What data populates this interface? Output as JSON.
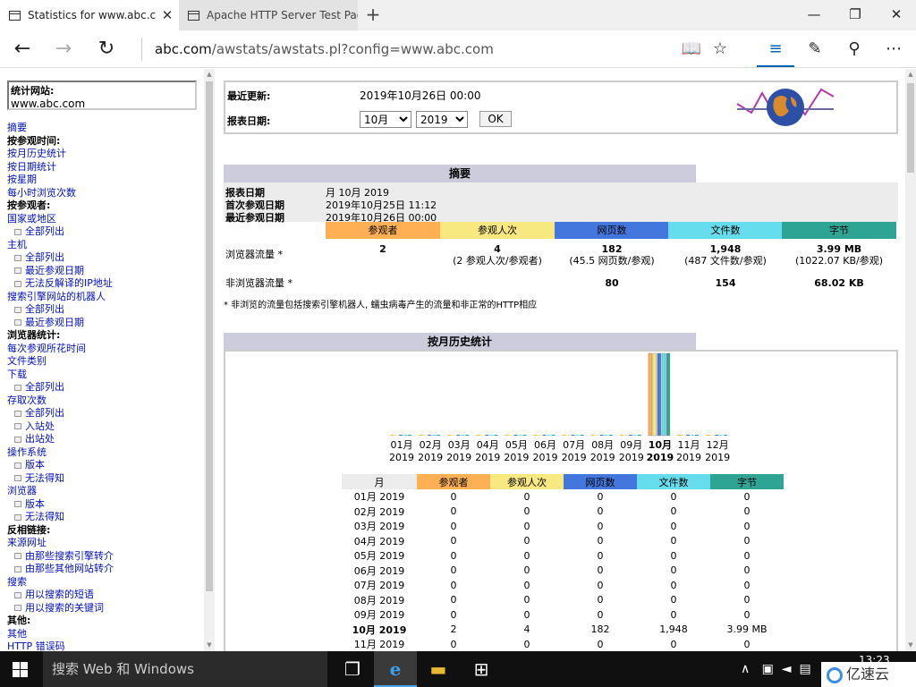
{
  "browser": {
    "tabs": [
      {
        "title": "Statistics for www.abc.co",
        "active": true
      },
      {
        "title": "Apache HTTP Server Test Pag",
        "active": false
      }
    ],
    "new_tab": "+",
    "address": {
      "host": "abc.com",
      "path": "/awstats/awstats.pl?config=www.abc.com"
    },
    "icons": [
      "back-icon",
      "forward-icon",
      "refresh-icon",
      "reading-view-icon",
      "favorites-star-icon",
      "hub-icon",
      "web-note-icon",
      "share-icon",
      "more-icon"
    ]
  },
  "left": {
    "site_label": "统计网站:",
    "site_value": "www.abc.com",
    "menu": [
      {
        "type": "link",
        "text": "摘要"
      },
      {
        "type": "head",
        "text": "按参观时间:"
      },
      {
        "type": "link",
        "text": "按月历史统计"
      },
      {
        "type": "link",
        "text": "按日期统计"
      },
      {
        "type": "link",
        "text": "按星期"
      },
      {
        "type": "link",
        "text": "每小时浏览次数"
      },
      {
        "type": "head",
        "text": "按参观者:"
      },
      {
        "type": "link",
        "text": "国家或地区"
      },
      {
        "type": "sub",
        "text": "全部列出"
      },
      {
        "type": "link",
        "text": "主机"
      },
      {
        "type": "sub",
        "text": "全部列出"
      },
      {
        "type": "sub",
        "text": "最近参观日期"
      },
      {
        "type": "sub",
        "text": "无法反解译的IP地址"
      },
      {
        "type": "link",
        "text": "搜索引擎网站的机器人"
      },
      {
        "type": "sub",
        "text": "全部列出"
      },
      {
        "type": "sub",
        "text": "最近参观日期"
      },
      {
        "type": "head",
        "text": "浏览器统计:"
      },
      {
        "type": "link",
        "text": "每次参观所花时间"
      },
      {
        "type": "link",
        "text": "文件类别"
      },
      {
        "type": "link",
        "text": "下载"
      },
      {
        "type": "sub",
        "text": "全部列出"
      },
      {
        "type": "link",
        "text": "存取次数"
      },
      {
        "type": "sub",
        "text": "全部列出"
      },
      {
        "type": "sub",
        "text": "入站处"
      },
      {
        "type": "sub",
        "text": "出站处"
      },
      {
        "type": "link",
        "text": "操作系统"
      },
      {
        "type": "sub",
        "text": "版本"
      },
      {
        "type": "sub",
        "text": "无法得知"
      },
      {
        "type": "link",
        "text": "浏览器"
      },
      {
        "type": "sub",
        "text": "版本"
      },
      {
        "type": "sub",
        "text": "无法得知"
      },
      {
        "type": "head",
        "text": "反相链接:"
      },
      {
        "type": "link",
        "text": "来源网址"
      },
      {
        "type": "sub",
        "text": "由那些搜索引擎转介"
      },
      {
        "type": "sub",
        "text": "由那些其他网站转介"
      },
      {
        "type": "link",
        "text": "搜索"
      },
      {
        "type": "sub",
        "text": "用以搜索的短语"
      },
      {
        "type": "sub",
        "text": "用以搜索的关键词"
      },
      {
        "type": "head",
        "text": "其他:"
      },
      {
        "type": "link",
        "text": "其他"
      },
      {
        "type": "link",
        "text": "HTTP 错误码"
      }
    ]
  },
  "top": {
    "last_update_label": "最近更新:",
    "last_update_value": "2019年10月26日 00:00",
    "report_date_label": "报表日期:",
    "month_select": "10月",
    "year_select": "2019",
    "ok_label": "OK"
  },
  "summary": {
    "title": "摘要",
    "report_date_label": "报表日期",
    "report_date_value": "月 10月 2019",
    "first_visit_label": "首次参观日期",
    "first_visit_value": "2019年10月25日 11:12",
    "last_visit_label": "最近参观日期",
    "last_visit_value": "2019年10月26日 00:00",
    "columns": [
      "参观者",
      "参观人次",
      "网页数",
      "文件数",
      "字节"
    ],
    "column_colors": [
      "#ffb055",
      "#f8e880",
      "#4477dd",
      "#66dded",
      "#2ea495"
    ],
    "viewed_label": "浏览器流量 *",
    "viewed_values": [
      "2",
      "4",
      "182",
      "1,948",
      "3.99 MB"
    ],
    "viewed_sub": [
      "",
      "(2 参观人次/参观者)",
      "(45.5 网页数/参观)",
      "(487 文件数/参观)",
      "(1022.07 KB/参观)"
    ],
    "notviewed_label": "非浏览器流量 *",
    "notviewed_values": [
      "",
      "",
      "80",
      "154",
      "68.02 KB"
    ],
    "footnote": "* 非浏览的流量包括搜索引擎机器人, 蠕虫病毒产生的流量和非正常的HTTP相应"
  },
  "monthly": {
    "title": "按月历史统计",
    "table_headers": [
      "月",
      "参观者",
      "参观人次",
      "网页数",
      "文件数",
      "字节"
    ],
    "rows": [
      [
        "01月 2019",
        "0",
        "0",
        "0",
        "0",
        "0"
      ],
      [
        "02月 2019",
        "0",
        "0",
        "0",
        "0",
        "0"
      ],
      [
        "03月 2019",
        "0",
        "0",
        "0",
        "0",
        "0"
      ],
      [
        "04月 2019",
        "0",
        "0",
        "0",
        "0",
        "0"
      ],
      [
        "05月 2019",
        "0",
        "0",
        "0",
        "0",
        "0"
      ],
      [
        "06月 2019",
        "0",
        "0",
        "0",
        "0",
        "0"
      ],
      [
        "07月 2019",
        "0",
        "0",
        "0",
        "0",
        "0"
      ],
      [
        "08月 2019",
        "0",
        "0",
        "0",
        "0",
        "0"
      ],
      [
        "09月 2019",
        "0",
        "0",
        "0",
        "0",
        "0"
      ],
      [
        "10月 2019",
        "2",
        "4",
        "182",
        "1,948",
        "3.99 MB"
      ],
      [
        "11月 2019",
        "0",
        "0",
        "0",
        "0",
        "0"
      ]
    ],
    "current_row": 9
  },
  "chart_data": {
    "type": "bar",
    "categories": [
      "01月\n2019",
      "02月\n2019",
      "03月\n2019",
      "04月\n2019",
      "05月\n2019",
      "06月\n2019",
      "07月\n2019",
      "08月\n2019",
      "09月\n2019",
      "10月\n2019",
      "11月\n2019",
      "12月\n2019"
    ],
    "highlight_category": "10月\n2019",
    "series": [
      {
        "name": "参观者",
        "color": "#ffb055",
        "values": [
          0,
          0,
          0,
          0,
          0,
          0,
          0,
          0,
          0,
          2,
          0,
          0
        ]
      },
      {
        "name": "参观人次",
        "color": "#f8e880",
        "values": [
          0,
          0,
          0,
          0,
          0,
          0,
          0,
          0,
          0,
          4,
          0,
          0
        ]
      },
      {
        "name": "网页数",
        "color": "#4477dd",
        "values": [
          0,
          0,
          0,
          0,
          0,
          0,
          0,
          0,
          0,
          182,
          0,
          0
        ]
      },
      {
        "name": "文件数",
        "color": "#66dded",
        "values": [
          0,
          0,
          0,
          0,
          0,
          0,
          0,
          0,
          0,
          1948,
          0,
          0
        ]
      },
      {
        "name": "字节",
        "color": "#2ea495",
        "values": [
          0,
          0,
          0,
          0,
          0,
          0,
          0,
          0,
          0,
          3.99,
          0,
          0
        ]
      }
    ]
  },
  "taskbar": {
    "search_placeholder": "搜索 Web 和 Windows",
    "clock": "13:23",
    "watermark": "亿速云"
  }
}
